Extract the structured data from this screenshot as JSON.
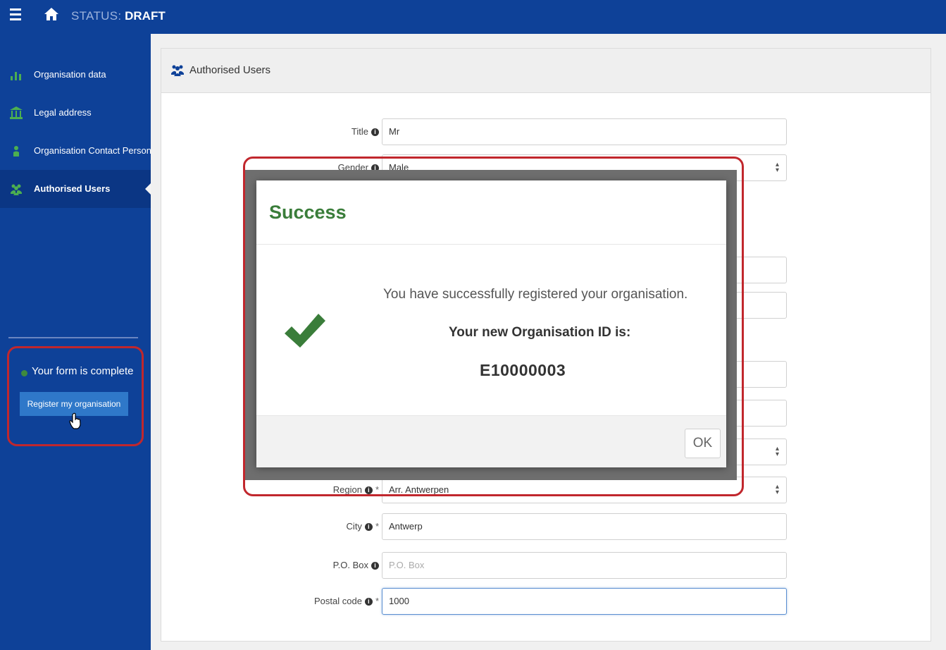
{
  "header": {
    "status_label": "STATUS:",
    "status_value": "DRAFT",
    "menu_icon": "hamburger-icon",
    "home_icon": "home-icon"
  },
  "sidebar": {
    "items": [
      {
        "label": "Organisation data",
        "icon": "org-chart-icon"
      },
      {
        "label": "Legal address",
        "icon": "building-icon"
      },
      {
        "label": "Organisation Contact Person",
        "icon": "person-icon"
      },
      {
        "label": "Authorised Users",
        "icon": "users-icon",
        "active": true
      }
    ],
    "form_status": "Your form is complete",
    "register_label": "Register my organisation"
  },
  "panel": {
    "title": "Authorised Users",
    "fields": {
      "title": {
        "label": "Title",
        "value": "Mr"
      },
      "gender": {
        "label": "Gender",
        "value": "Male"
      },
      "region": {
        "label": "Region",
        "value": "Arr. Antwerpen"
      },
      "city": {
        "label": "City",
        "value": "Antwerp"
      },
      "pobox": {
        "label": "P.O. Box",
        "placeholder": "P.O. Box"
      },
      "postal": {
        "label": "Postal code",
        "value": "1000"
      }
    }
  },
  "modal": {
    "title": "Success",
    "message": "You have successfully registered your organisation.",
    "id_label": "Your new Organisation ID is:",
    "org_id": "E10000003",
    "ok_label": "OK"
  },
  "colors": {
    "brand_blue": "#0e4198",
    "success_green": "#3a7d3a",
    "highlight_red": "#c1272d",
    "button_blue": "#2f78c9"
  }
}
